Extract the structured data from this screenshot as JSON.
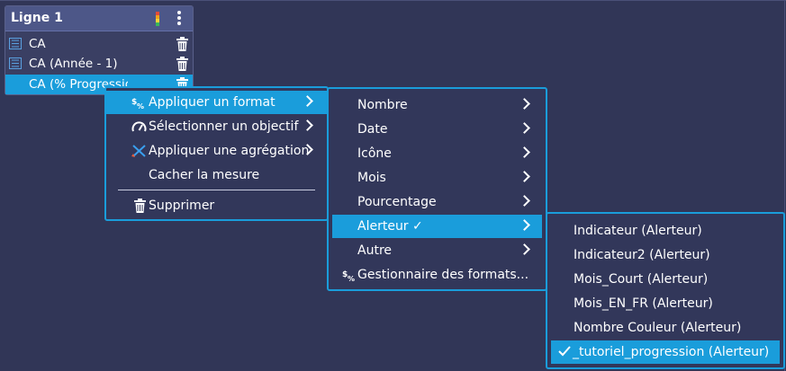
{
  "panel": {
    "title": "Ligne 1",
    "rows": [
      {
        "label": "CA"
      },
      {
        "label": "CA (Année - 1)"
      },
      {
        "label": "CA (% Progression)"
      }
    ]
  },
  "menu1": {
    "items": [
      {
        "label": "Appliquer un format",
        "icon": "dollar-percent-icon"
      },
      {
        "label": "Sélectionner un objectif",
        "icon": "gauge-icon"
      },
      {
        "label": "Appliquer une agrégation",
        "icon": "crossed-arrows-icon"
      },
      {
        "label": "Cacher la mesure"
      },
      {
        "label": "Supprimer",
        "icon": "trash-icon"
      }
    ]
  },
  "menu2": {
    "items": [
      {
        "label": "Nombre"
      },
      {
        "label": "Date"
      },
      {
        "label": "Icône"
      },
      {
        "label": "Mois"
      },
      {
        "label": "Pourcentage"
      },
      {
        "label": "Alerteur ✓"
      },
      {
        "label": "Autre"
      },
      {
        "label": "Gestionnaire des formats...",
        "icon": "dollar-percent-icon"
      }
    ]
  },
  "menu3": {
    "items": [
      {
        "label": "Indicateur (Alerteur)"
      },
      {
        "label": "Indicateur2 (Alerteur)"
      },
      {
        "label": "Mois_Court (Alerteur)"
      },
      {
        "label": "Mois_EN_FR (Alerteur)"
      },
      {
        "label": "Nombre Couleur (Alerteur)"
      },
      {
        "label": "_tutoriel_progression (Alerteur)",
        "icon": "check-icon"
      }
    ]
  },
  "colors": {
    "background": "#313657",
    "accent": "#1a9ddb",
    "panel_header": "#4d5788"
  }
}
